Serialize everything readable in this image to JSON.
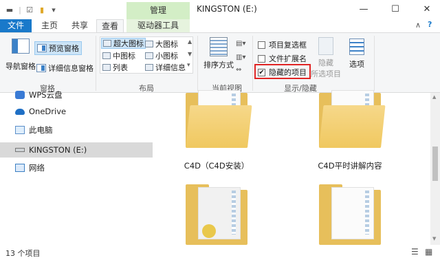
{
  "window": {
    "title": "KINGSTON (E:)",
    "context_tab": "管理",
    "minimize": "—",
    "maximize": "☐",
    "close": "✕"
  },
  "tabs": {
    "file": "文件",
    "home": "主页",
    "share": "共享",
    "view": "查看",
    "drive_tools": "驱动器工具"
  },
  "ribbon": {
    "panes": {
      "nav_pane": "导航窗格",
      "preview_pane": "预览窗格",
      "details_pane": "详细信息窗格",
      "group_label": "窗格"
    },
    "layout": {
      "extra_large": "超大图标",
      "large": "大图标",
      "medium": "中图标",
      "small": "小图标",
      "list": "列表",
      "details": "详细信息",
      "group_label": "布局"
    },
    "current_view": {
      "sort_by": "排序方式",
      "group_label": "当前视图"
    },
    "show_hide": {
      "item_checkboxes": "项目复选框",
      "file_extensions": "文件扩展名",
      "hidden_items": "隐藏的项目",
      "hidden_items_checked": "✔",
      "hide_selected": "隐藏",
      "hide_selected_sub": "所选项目",
      "group_label": "显示/隐藏"
    },
    "options": "选项"
  },
  "nav": {
    "items": [
      {
        "label": "WPS云盘"
      },
      {
        "label": "OneDrive"
      },
      {
        "label": "此电脑"
      },
      {
        "label": "KINGSTON (E:)"
      },
      {
        "label": "网络"
      }
    ]
  },
  "folders": [
    {
      "name": "C4D（C4D安装）"
    },
    {
      "name": "C4D平时讲解内容"
    }
  ],
  "status": {
    "count": "13 个项目"
  }
}
